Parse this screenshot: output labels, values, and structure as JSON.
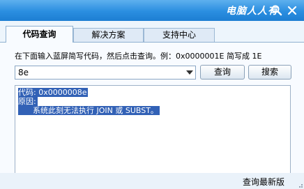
{
  "window": {
    "brand": "电脑人人有"
  },
  "tabs": [
    {
      "label": "代码查询",
      "active": true
    },
    {
      "label": "解决方案",
      "active": false
    },
    {
      "label": "支持中心",
      "active": false
    }
  ],
  "query": {
    "instruction": "在下面输入蓝屏简写代码，然后点击查询。例：0x0000001E 简写成 1E",
    "input_value": "8e",
    "query_button": "查询",
    "search_button": "搜索"
  },
  "result": {
    "lines": [
      "代码: 0x0000008e",
      "原因:",
      "      系统此刻无法执行 JOIN 或 SUBST。"
    ]
  },
  "footer": {
    "update_label": "查询最新版"
  },
  "icons": {
    "search": "search-icon",
    "close": "close-icon"
  },
  "colors": {
    "titlebar": "#2a8ee0",
    "selection": "#3261b6",
    "panel": "#f8fbff"
  }
}
